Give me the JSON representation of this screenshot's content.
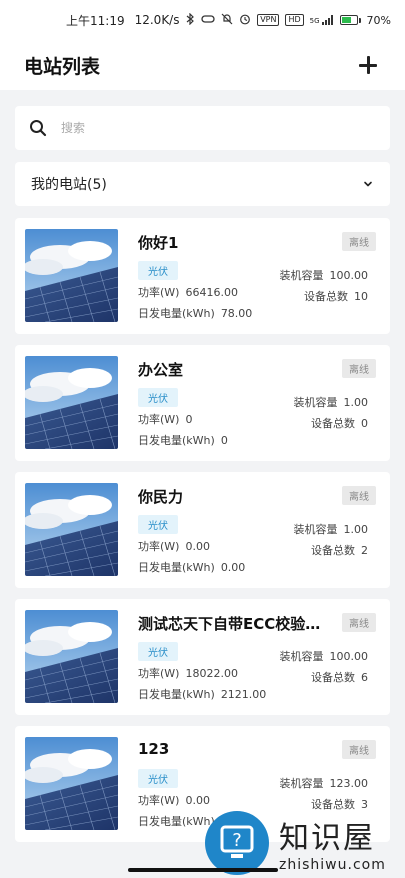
{
  "status_bar": {
    "time": "上午11:19",
    "net_speed": "12.0K/s",
    "vpn_badge": "VPN",
    "hd_badge": "HD",
    "signal_label": "5G",
    "battery_percent": "70%",
    "battery_level": 0.7
  },
  "header": {
    "title": "电站列表"
  },
  "search": {
    "placeholder": "搜索",
    "value": ""
  },
  "section": {
    "title": "我的电站(5)"
  },
  "stations": [
    {
      "name": "你好1",
      "status": "离线",
      "type": "光伏",
      "capacity_label": "装机容量",
      "capacity": "100.00",
      "power_label": "功率(W)",
      "power": "66416.00",
      "device_label": "设备总数",
      "devices": "10",
      "energy_label": "日发电量(kWh)",
      "energy": "78.00"
    },
    {
      "name": "办公室",
      "status": "离线",
      "type": "光伏",
      "capacity_label": "装机容量",
      "capacity": "1.00",
      "power_label": "功率(W)",
      "power": "0",
      "device_label": "设备总数",
      "devices": "0",
      "energy_label": "日发电量(kWh)",
      "energy": "0"
    },
    {
      "name": "你民力",
      "status": "离线",
      "type": "光伏",
      "capacity_label": "装机容量",
      "capacity": "1.00",
      "power_label": "功率(W)",
      "power": "0.00",
      "device_label": "设备总数",
      "devices": "2",
      "energy_label": "日发电量(kWh)",
      "energy": "0.00"
    },
    {
      "name": "测试芯天下自带ECC校验…",
      "status": "离线",
      "type": "光伏",
      "capacity_label": "装机容量",
      "capacity": "100.00",
      "power_label": "功率(W)",
      "power": "18022.00",
      "device_label": "设备总数",
      "devices": "6",
      "energy_label": "日发电量(kWh)",
      "energy": "2121.00"
    },
    {
      "name": "123",
      "status": "离线",
      "type": "光伏",
      "capacity_label": "装机容量",
      "capacity": "123.00",
      "power_label": "功率(W)",
      "power": "0.00",
      "device_label": "设备总数",
      "devices": "3",
      "energy_label": "日发电量(kWh)",
      "energy": ""
    }
  ],
  "watermark": {
    "cn": "知识屋",
    "domain": "zhishiwu.com"
  },
  "colors": {
    "accent": "#2a8fc9",
    "badge_bg": "#e3f3fb",
    "offline_bg": "#e9e9e9",
    "title_underline": "#8fd3f2"
  }
}
